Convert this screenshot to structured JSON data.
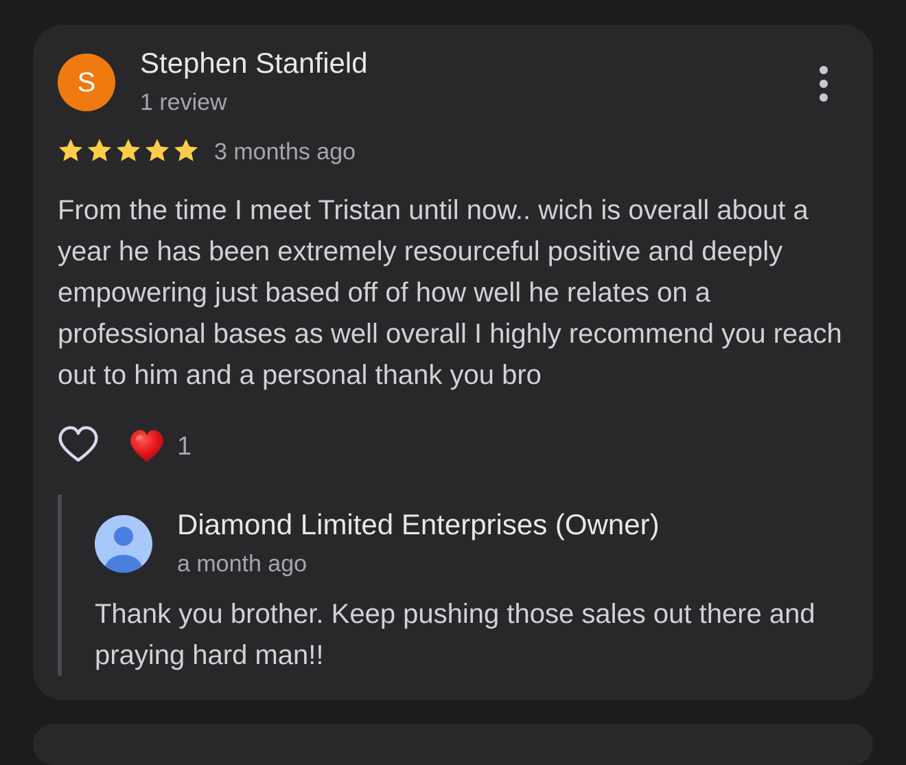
{
  "review": {
    "avatar_letter": "S",
    "avatar_color": "#f07a10",
    "reviewer_name": "Stephen Stanfield",
    "review_count": "1 review",
    "rating": 5,
    "rating_max": 5,
    "star_color": "#fbcd49",
    "time": "3 months ago",
    "text": "From the time I meet Tristan until now.. wich is overall about a year he has been extremely resourceful positive and deeply empowering just based off of how well he relates on a professional bases as well overall I highly recommend you reach out to him and a personal thank you bro",
    "more_icon": "more-vert-icon",
    "like_icon": "heart-outline-icon",
    "reaction_icon": "red-heart-icon",
    "reaction_count": "1"
  },
  "owner_reply": {
    "owner_name": "Diamond Limited Enterprises (Owner)",
    "time": "a month ago",
    "text": "Thank you brother. Keep pushing those sales out there and praying hard man!!",
    "avatar_icon": "person-icon"
  }
}
